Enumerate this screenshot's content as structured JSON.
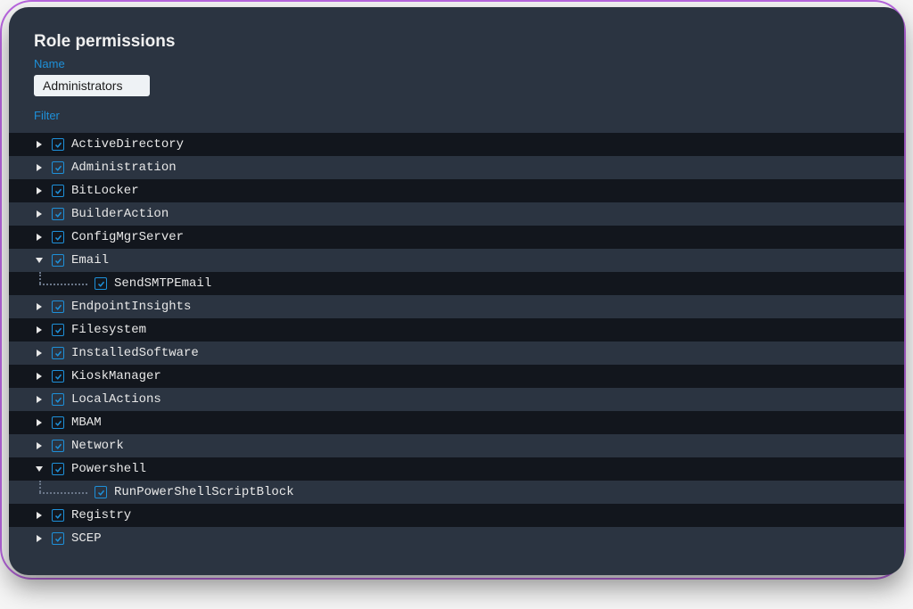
{
  "header": {
    "title": "Role permissions",
    "name_label": "Name",
    "name_value": "Administrators",
    "filter_label": "Filter"
  },
  "colors": {
    "accent": "#1e90d9",
    "row_dark": "#12161d",
    "row_light": "#2b3441"
  },
  "tree": [
    {
      "label": "ActiveDirectory",
      "expanded": false,
      "checked": true,
      "depth": 0,
      "stripe": "odd"
    },
    {
      "label": "Administration",
      "expanded": false,
      "checked": true,
      "depth": 0,
      "stripe": "even"
    },
    {
      "label": "BitLocker",
      "expanded": false,
      "checked": true,
      "depth": 0,
      "stripe": "odd"
    },
    {
      "label": "BuilderAction",
      "expanded": false,
      "checked": true,
      "depth": 0,
      "stripe": "even"
    },
    {
      "label": "ConfigMgrServer",
      "expanded": false,
      "checked": true,
      "depth": 0,
      "stripe": "odd"
    },
    {
      "label": "Email",
      "expanded": true,
      "checked": true,
      "depth": 0,
      "stripe": "even"
    },
    {
      "label": "SendSMTPEmail",
      "expanded": null,
      "checked": true,
      "depth": 1,
      "stripe": "odd"
    },
    {
      "label": "EndpointInsights",
      "expanded": false,
      "checked": true,
      "depth": 0,
      "stripe": "even"
    },
    {
      "label": "Filesystem",
      "expanded": false,
      "checked": true,
      "depth": 0,
      "stripe": "odd"
    },
    {
      "label": "InstalledSoftware",
      "expanded": false,
      "checked": true,
      "depth": 0,
      "stripe": "even"
    },
    {
      "label": "KioskManager",
      "expanded": false,
      "checked": true,
      "depth": 0,
      "stripe": "odd"
    },
    {
      "label": "LocalActions",
      "expanded": false,
      "checked": true,
      "depth": 0,
      "stripe": "even"
    },
    {
      "label": "MBAM",
      "expanded": false,
      "checked": true,
      "depth": 0,
      "stripe": "odd"
    },
    {
      "label": "Network",
      "expanded": false,
      "checked": true,
      "depth": 0,
      "stripe": "even"
    },
    {
      "label": "Powershell",
      "expanded": true,
      "checked": true,
      "depth": 0,
      "stripe": "odd"
    },
    {
      "label": "RunPowerShellScriptBlock",
      "expanded": null,
      "checked": true,
      "depth": 1,
      "stripe": "even"
    },
    {
      "label": "Registry",
      "expanded": false,
      "checked": true,
      "depth": 0,
      "stripe": "odd"
    },
    {
      "label": "SCEP",
      "expanded": false,
      "checked": true,
      "depth": 0,
      "stripe": "even"
    }
  ]
}
